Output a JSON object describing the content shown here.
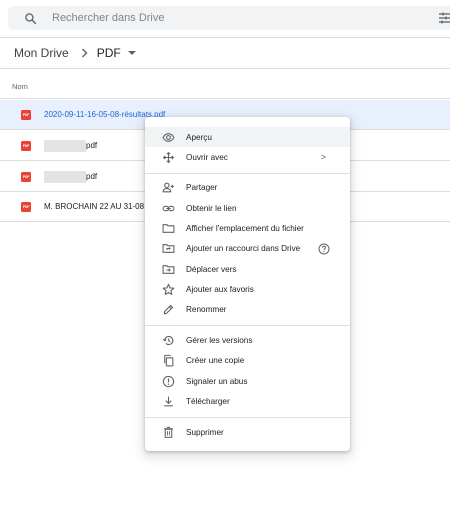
{
  "search": {
    "placeholder": "Rechercher dans Drive"
  },
  "breadcrumb": {
    "root": "Mon Drive",
    "current": "PDF"
  },
  "file_list": {
    "column_header": "Nom",
    "files": [
      {
        "name": "2020-09-11-16-05-08-résultats.pdf",
        "selected": true
      },
      {
        "name": "pdf",
        "redacted": true
      },
      {
        "name": "pdf",
        "redacted": true
      },
      {
        "name": "M. BROCHAIN 22 AU 31-08"
      }
    ],
    "file_type_badge": "PDF"
  },
  "context_menu": {
    "items": [
      {
        "label": "Aperçu",
        "icon": "eye-icon"
      },
      {
        "label": "Ouvrir avec",
        "icon": "move-arrows-icon",
        "submenu_arrow": ">"
      },
      {
        "label": "Partager",
        "icon": "person-add-icon"
      },
      {
        "label": "Obtenir le lien",
        "icon": "link-icon"
      },
      {
        "label": "Afficher l'emplacement du fichier",
        "icon": "folder-icon"
      },
      {
        "label": "Ajouter un raccourci dans Drive",
        "icon": "shortcut-icon"
      },
      {
        "label": "Déplacer vers",
        "icon": "move-to-icon"
      },
      {
        "label": "Ajouter aux favoris",
        "icon": "star-icon"
      },
      {
        "label": "Renommer",
        "icon": "pencil-icon"
      },
      {
        "label": "Gérer les versions",
        "icon": "history-icon"
      },
      {
        "label": "Créer une copie",
        "icon": "copy-icon"
      },
      {
        "label": "Signaler un abus",
        "icon": "report-icon"
      },
      {
        "label": "Télécharger",
        "icon": "download-icon"
      },
      {
        "label": "Supprimer",
        "icon": "trash-icon"
      }
    ]
  },
  "colors": {
    "accent": "#1967d2",
    "selected_row": "#e8f0fe",
    "pdf_red": "#ea4335"
  }
}
